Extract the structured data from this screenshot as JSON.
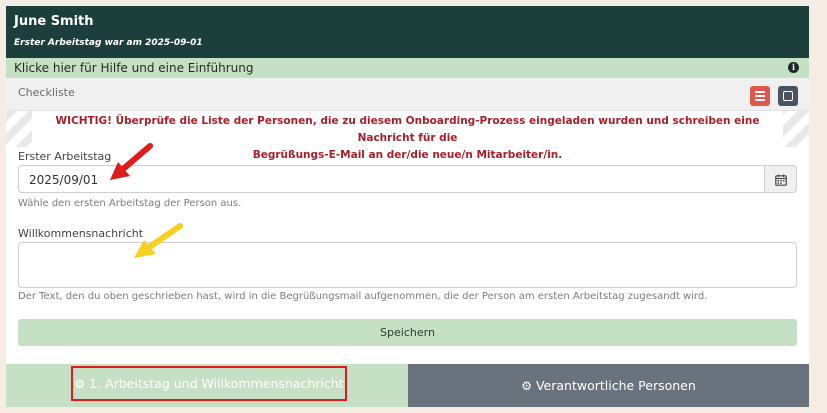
{
  "header": {
    "name": "June Smith",
    "subtitle": "Erster Arbeitstag war am 2025-09-01"
  },
  "help": {
    "text": "Klicke hier für Hilfe und eine Einführung",
    "icon": "info-icon"
  },
  "checklist": {
    "label": "Checkliste",
    "icons": [
      "list-icon",
      "square-icon"
    ]
  },
  "warning": {
    "line1": "WICHTIG! Überprüfe die Liste der Personen, die zu diesem Onboarding-Prozess eingeladen wurden und schreiben eine Nachricht für die",
    "line2": "Begrüßungs-E-Mail an der/die neue/n Mitarbeiter/in."
  },
  "first_day": {
    "label": "Erster Arbeitstag",
    "value": "2025/09/01",
    "hint": "Wähle den ersten Arbeitstag der Person aus.",
    "icon": "calendar-icon"
  },
  "welcome": {
    "label": "Willkommensnachricht",
    "value": "",
    "hint": "Der Text, den du oben geschrieben hast, wird in die Begrüßungsmail aufgenommen, die der Person am ersten Arbeitstag zugesandt wird."
  },
  "save_label": "Speichern",
  "tabs": [
    {
      "label": "1. Arbeitstag und Willkommensnachricht",
      "icon": "gear-icon"
    },
    {
      "label": "Verantwortliche Personen",
      "icon": "gear-icon"
    }
  ],
  "colors": {
    "header_bg": "#1d3f3b",
    "accent_green": "#c6e0c5",
    "warning_red": "#a81e2a",
    "tab_gray": "#6a737d",
    "annotation_red": "#e01b1b",
    "annotation_yellow": "#f5d020"
  }
}
